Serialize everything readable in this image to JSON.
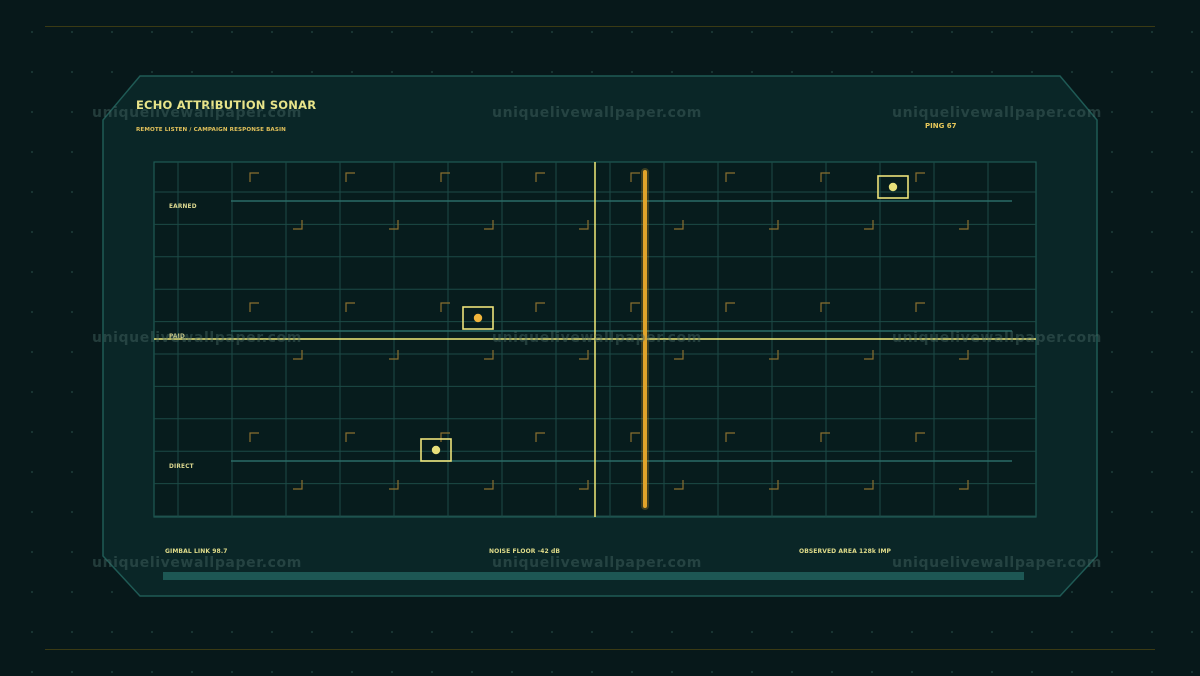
{
  "header": {
    "title": "ECHO ATTRIBUTION SONAR",
    "subtitle": "REMOTE LISTEN / CAMPAIGN RESPONSE BASIN",
    "ping": "PING 67"
  },
  "lanes": [
    {
      "label": "EARNED"
    },
    {
      "label": "PAID"
    },
    {
      "label": "DIRECT"
    }
  ],
  "footer": {
    "gimbal": "GIMBAL LINK 98.7",
    "noise": "NOISE FLOOR -42 dB",
    "observed": "OBSERVED AREA 128k IMP"
  },
  "watermark": "uniquelivewallpaper.com",
  "colors": {
    "background": "#07181a",
    "panel": "#0a2627",
    "panel_border": "#1f5a55",
    "grid": "#1c4a46",
    "crosshair": "#f0ea78",
    "scan_bar": "#e0a32a",
    "target_box": "#ede27a",
    "target_dot_gold": "#f0b43c",
    "target_dot_pale": "#e8e07a",
    "corner_marks": "#8a7030"
  }
}
